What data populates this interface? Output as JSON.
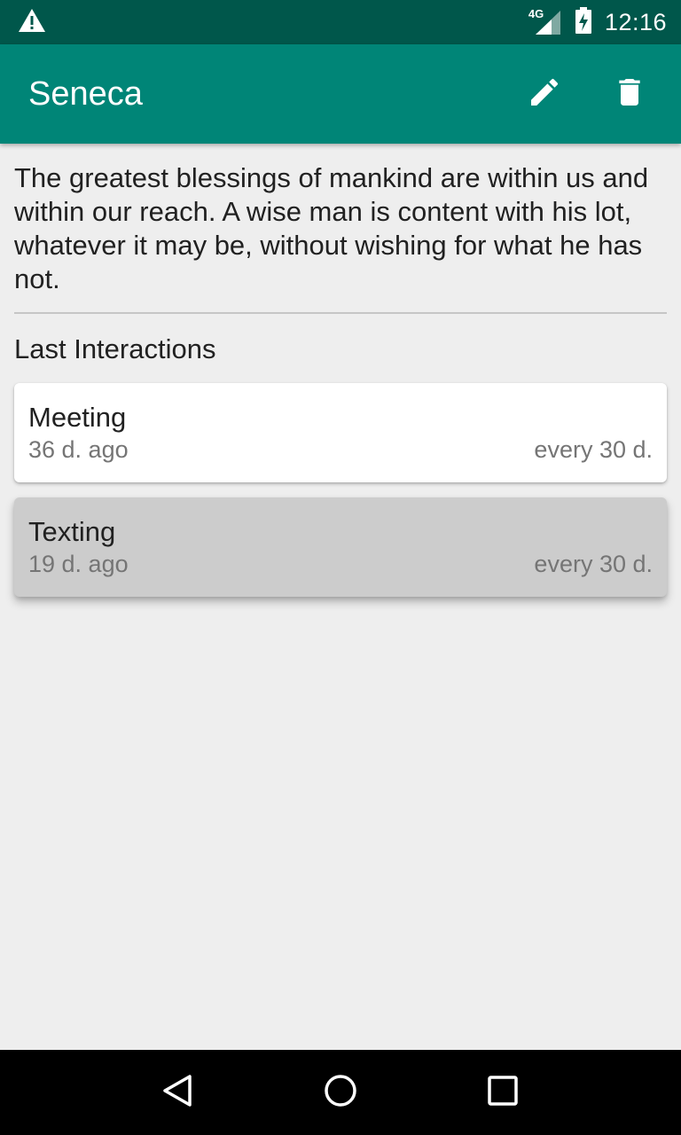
{
  "status_bar": {
    "network": "4G",
    "time": "12:16",
    "icons": [
      "warning-icon",
      "signal-icon",
      "battery-charging-icon"
    ]
  },
  "app_bar": {
    "title": "Seneca",
    "actions": [
      "edit-icon",
      "delete-icon"
    ],
    "color": "#008577"
  },
  "quote": {
    "text": "The greatest blessings of mankind are within us and within our reach. A wise man is content with his lot, whatever it may be, without wishing for what he has not."
  },
  "interactions": {
    "heading": "Last Interactions",
    "items": [
      {
        "title": "Meeting",
        "ago": "36 d. ago",
        "frequency": "every 30 d."
      },
      {
        "title": "Texting",
        "ago": "19 d. ago",
        "frequency": "every 30 d."
      }
    ]
  },
  "nav_bar": {
    "buttons": [
      "back-icon",
      "home-icon",
      "recents-icon"
    ]
  }
}
